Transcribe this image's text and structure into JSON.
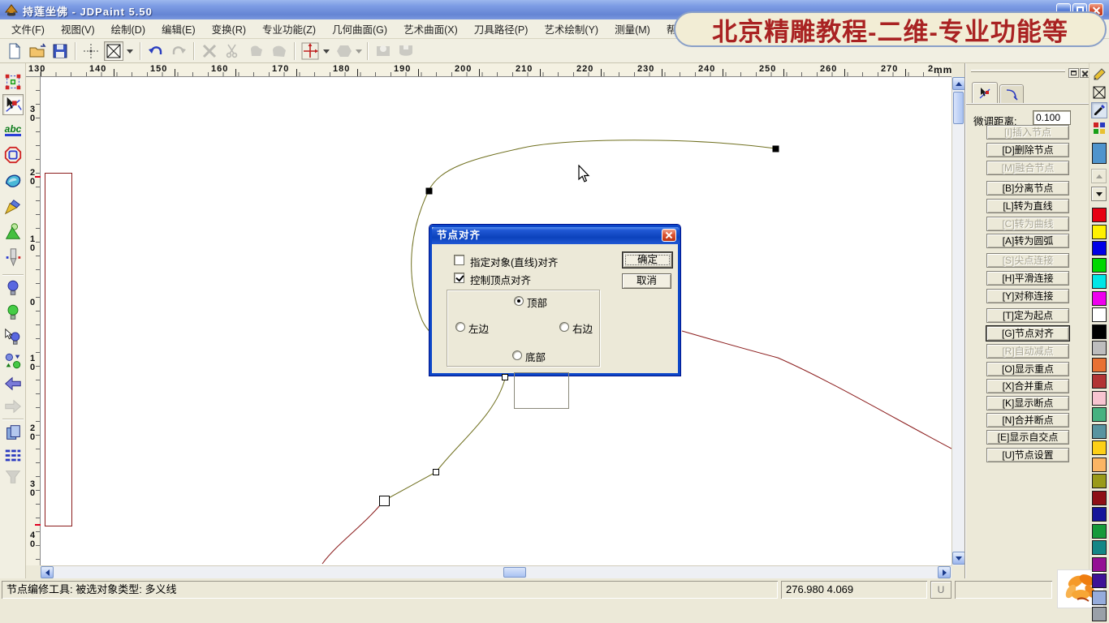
{
  "window": {
    "title": "持莲坐佛 - JDPaint 5.50"
  },
  "banner": {
    "text": "北京精雕教程-二维-专业功能等",
    "bg": "#f2edd5",
    "fg": "#a92222"
  },
  "menu_items": [
    "文件(F)",
    "视图(V)",
    "绘制(D)",
    "编辑(E)",
    "变换(R)",
    "专业功能(Z)",
    "几何曲面(G)",
    "艺术曲面(X)",
    "刀具路径(P)",
    "艺术绘制(Y)",
    "测量(M)",
    "帮助(H)"
  ],
  "toolbar_icons": [
    "new-file",
    "open-folder",
    "save",
    "crosshair",
    "selection-box",
    "undo",
    "redo",
    "delete",
    "cut",
    "copy-shape",
    "paste-shape",
    "axes",
    "surface",
    "tool-a",
    "tool-b"
  ],
  "left_toolbar": {
    "abc_label": "abc",
    "icons": [
      "marquee-select",
      "node-edit",
      "text",
      "octagon-shape",
      "curve-shape",
      "pen",
      "cone-3d",
      "cnc-drill",
      "bulb-blue",
      "bulb-green",
      "bulb-pick",
      "swap-rotate",
      "arrow-back",
      "arrow-forward",
      "copy-pages",
      "dash-table",
      "funnel"
    ]
  },
  "ruler": {
    "h_labels": [
      "130",
      "140",
      "150",
      "160",
      "170",
      "180",
      "190",
      "200",
      "210",
      "220",
      "230",
      "240",
      "250",
      "260",
      "270"
    ],
    "h_end": "2",
    "unit": "mm",
    "v_labels": [
      "30",
      "20",
      "10",
      "0",
      "10",
      "20",
      "30",
      "40"
    ]
  },
  "panel": {
    "nudge_label": "微调距离:",
    "nudge_value": "0.100",
    "buttons": [
      {
        "label": "[I]插入节点",
        "state": "disabled"
      },
      {
        "label": "[D]删除节点",
        "state": "normal"
      },
      {
        "label": "[M]融合节点",
        "state": "disabled"
      },
      {
        "label": "[B]分离节点",
        "state": "normal"
      },
      {
        "label": "[L]转为直线",
        "state": "normal"
      },
      {
        "label": "[C]转为曲线",
        "state": "disabled"
      },
      {
        "label": "[A]转为圆弧",
        "state": "normal"
      },
      {
        "label": "[S]尖点连接",
        "state": "disabled"
      },
      {
        "label": "[H]平滑连接",
        "state": "normal"
      },
      {
        "label": "[Y]对称连接",
        "state": "normal"
      },
      {
        "label": "[T]定为起点",
        "state": "normal"
      },
      {
        "label": "[G]节点对齐",
        "state": "active"
      },
      {
        "label": "[R]自动减点",
        "state": "disabled"
      },
      {
        "label": "[O]显示重点",
        "state": "normal"
      },
      {
        "label": "[X]合并重点",
        "state": "normal"
      },
      {
        "label": "[K]显示断点",
        "state": "normal"
      },
      {
        "label": "[N]合并断点",
        "state": "normal"
      },
      {
        "label": "[E]显示自交点",
        "state": "normal"
      },
      {
        "label": "[U]节点设置",
        "state": "normal"
      }
    ]
  },
  "dialog": {
    "title": "节点对齐",
    "checkboxes": [
      {
        "label": "指定对象(直线)对齐",
        "state": "unchecked"
      },
      {
        "label": "控制顶点对齐",
        "state": "checked"
      }
    ],
    "radios": {
      "top": {
        "label": "顶部",
        "state": "selected"
      },
      "left": {
        "label": "左边",
        "state": "normal"
      },
      "right": {
        "label": "右边",
        "state": "normal"
      },
      "bottom": {
        "label": "底部",
        "state": "normal"
      }
    },
    "ok_label": "确定",
    "cancel_label": "取消"
  },
  "status": {
    "message": "节点编修工具: 被选对象类型: 多义线",
    "coords": "276.980 4.069",
    "u_label": "U"
  },
  "colors": {
    "current": "#4f94cd",
    "curve_olive": "#6f6f1e",
    "curve_red": "#8b1c1c",
    "palette": [
      "#e60012",
      "#fff100",
      "#0000e6",
      "#00d800",
      "#00e6e6",
      "#ee00ee",
      "#ffffff",
      "#000000",
      "#bdbdbd",
      "#e87132",
      "#b23434",
      "#f7c4d0",
      "#46b280",
      "#5894a0",
      "#fdd017",
      "#fbb564",
      "#9a9a1a",
      "#8e1016",
      "#16169a",
      "#169a3a",
      "#148686",
      "#941094",
      "#3e1296",
      "#96acdc",
      "#9aa0a8"
    ]
  }
}
